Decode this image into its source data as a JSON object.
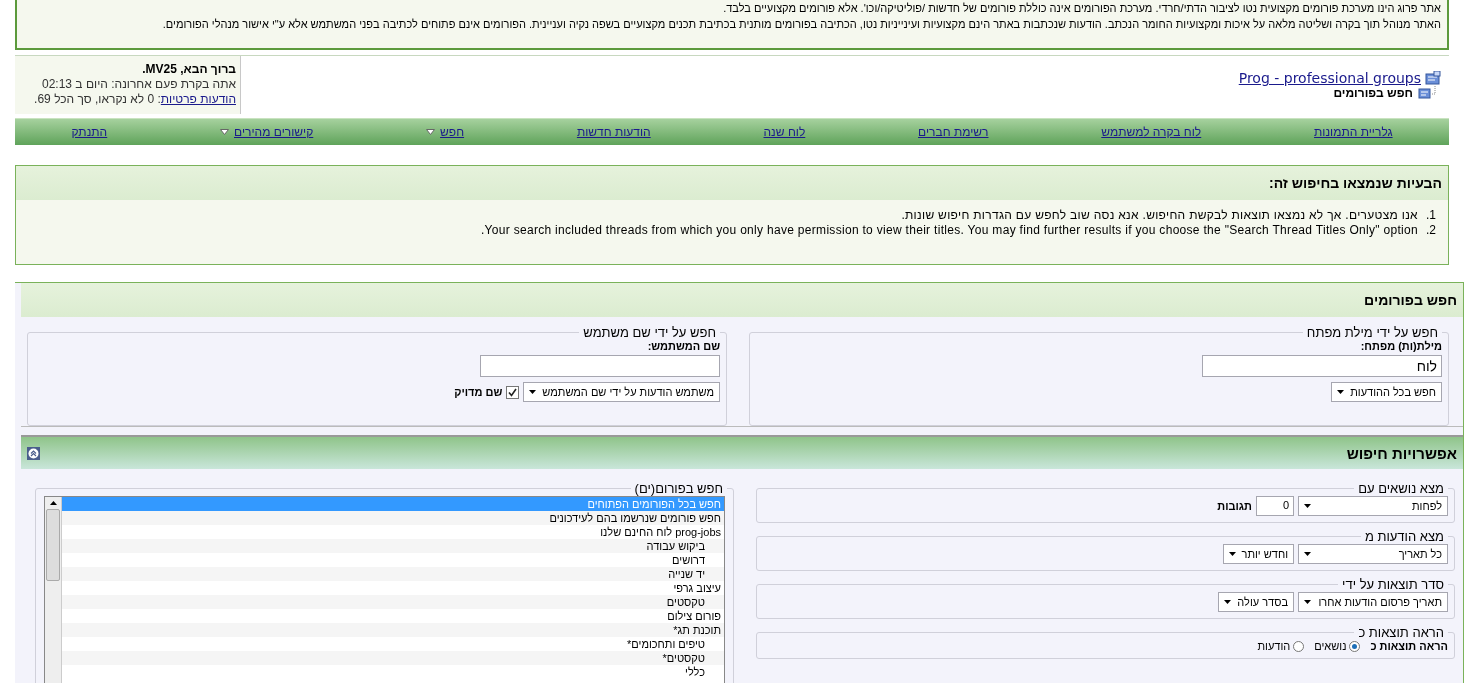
{
  "notice": {
    "lines": [
      "אתר פרוג הינו מערכת פורומים מקצועית נטו לציבור הדתי/חרדי. מערכת הפורומים אינה כוללת פורומים של חדשות /פוליטיקה/וכו'. אלא פורומים מקצועיים בלבד.",
      "האתר מנוהל תוך בקרה ושליטה מלאה על איכות ומקצועיות החומר הנכתב. הודעות שנכתבות באתר הינם מקצועיות ועינייניות נטו, הכתיבה בפורומים מותנית בכתיבת תכנים מקצועיים בשפה נקיה ועניינית. הפורומים אינם פתוחים לכתיבה בפני המשתמש אלא ע\"י אישור מנהלי הפורומים."
    ]
  },
  "breadcrumb": {
    "site": "Prog - professional groups",
    "page": "חפש בפורומים"
  },
  "user": {
    "welcome": "ברוך הבא, MV25.",
    "last_visit": "אתה בקרת פעם אחרונה: היום ב 02:13",
    "pm_link": "הודעות פרטיות",
    "pm_counts": ": 0 לא נקראו, סך הכל 69."
  },
  "nav": [
    {
      "label": "גלריית התמונות",
      "menu": false
    },
    {
      "label": "לוח בקרה למשתמש",
      "menu": false
    },
    {
      "label": "רשימת חברים",
      "menu": false
    },
    {
      "label": "לוח שנה",
      "menu": false
    },
    {
      "label": "הודעות חדשות",
      "menu": false
    },
    {
      "label": "חפש",
      "menu": true
    },
    {
      "label": "קישורים מהירים",
      "menu": true
    },
    {
      "label": "התנתק",
      "menu": false
    }
  ],
  "errors": {
    "title": "הבעיות שנמצאו בחיפוש זה:",
    "items": [
      {
        "number": "1.",
        "text": "אנו מצטערים. אך לא נמצאו תוצאות לבקשת החיפוש. אנא נסה שוב לחפש עם הגדרות חיפוש שונות."
      },
      {
        "number": "2.",
        "text": "Your search included threads from which you only have permission to view their titles. You may find further results if you choose the \"Search Thread Titles Only\" option."
      }
    ]
  },
  "search": {
    "title": "חפש בפורומים",
    "keyword": {
      "legend": "חפש על ידי מילת מפתח",
      "label": "מילת(ות) מפתח:",
      "value": "לוח",
      "scope": "חפש בכל ההודעות"
    },
    "username": {
      "legend": "חפש על ידי שם משתמש",
      "label": "שם המשתמש:",
      "mode": "משתמש הודעות על ידי שם המשתמש",
      "exact_label": "שם מדויק",
      "exact": true
    },
    "options_title": "אפשרויות חיפוש",
    "forums": {
      "legend": "חפש בפורום(ים)",
      "items": [
        {
          "label": "חפש בכל הפורומים הפתוחים",
          "selected": true
        },
        {
          "label": "חפש פורומים שנרשמו בהם לעידכונים",
          "selected": false
        },
        {
          "label": "prog-jobs לוח החינם שלנו",
          "selected": false,
          "children": [
            {
              "label": "ביקוש עבודה",
              "selected": false
            },
            {
              "label": "דרושים",
              "selected": false
            },
            {
              "label": "יד שנייה",
              "selected": false
            }
          ]
        },
        {
          "label": "עיצוב גרפי",
          "selected": false,
          "children": [
            {
              "label": "טקסטים",
              "selected": false
            }
          ]
        },
        {
          "label": "פורום צילום",
          "selected": false
        },
        {
          "label": "תוכנת תג*",
          "selected": false,
          "children": [
            {
              "label": "טיפים ותחכומים*",
              "selected": false
            },
            {
              "label": "טקסטים*",
              "selected": false
            },
            {
              "label": "כללי",
              "selected": false
            }
          ]
        }
      ]
    },
    "options": [
      {
        "legend": "מצא נושאים עם",
        "controls": [
          {
            "kind": "select",
            "value": "לפחות"
          },
          {
            "kind": "input",
            "value": "0"
          },
          {
            "kind": "text",
            "value": "תגובות"
          }
        ]
      },
      {
        "legend": "מצא הודעות מ",
        "controls": [
          {
            "kind": "select",
            "value": "כל תאריך"
          },
          {
            "kind": "select",
            "value": "וחדש יותר"
          }
        ]
      },
      {
        "legend": "סדר תוצאות על ידי",
        "controls": [
          {
            "kind": "select",
            "value": "תאריך פרסום הודעות אחרו"
          },
          {
            "kind": "select",
            "value": "בסדר עולה"
          }
        ]
      },
      {
        "legend": "הראה תוצאות כ",
        "controls": [
          {
            "kind": "text",
            "value": "הראה תוצאות כ"
          },
          {
            "kind": "radio",
            "value": "נושאים",
            "selected": true
          },
          {
            "kind": "radio",
            "value": "הודעות",
            "selected": false
          }
        ]
      }
    ]
  }
}
